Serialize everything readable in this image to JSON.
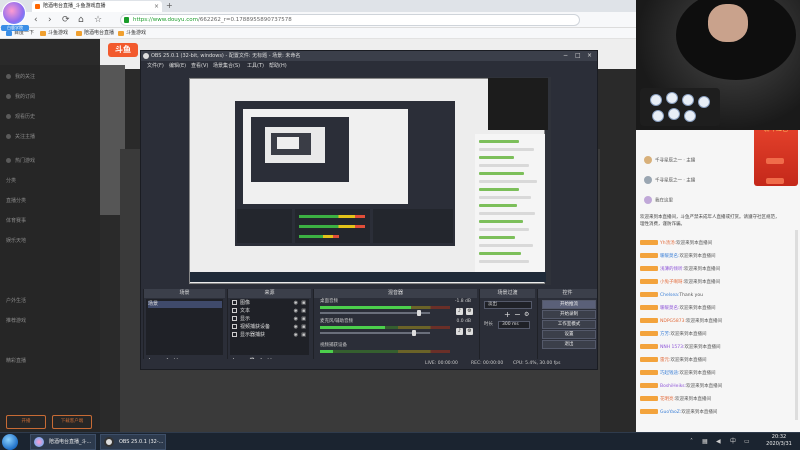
{
  "browser": {
    "logo_text": "白鹿学院",
    "tab_title": "陪酒电台直播_斗鱼游戏直播",
    "nav": {
      "back": "‹",
      "forward": "›",
      "reload": "⟳",
      "home": "⌂",
      "star": "☆"
    },
    "url_host": "https://www.douyu.com",
    "url_rest": "/662262_r=0.1788955890737578",
    "bookmarks": [
      "百度一下",
      "斗鱼游戏",
      "陪酒电台直播",
      "斗鱼游戏"
    ]
  },
  "obs": {
    "title": "OBS 25.0.1 (32-bit, windows) - 配置文件: 无标题 - 场景: 未命名",
    "menu": [
      "文件(F)",
      "编辑(E)",
      "查看(V)",
      "场景集合(S)",
      "工具(T)",
      "帮助(H)"
    ],
    "docks": {
      "scenes": {
        "header": "场景",
        "items": [
          "场景"
        ]
      },
      "sources": {
        "header": "来源",
        "items": [
          "图像",
          "文本",
          "显示",
          "视频捕获设备",
          "显示器捕获"
        ]
      },
      "mixer": {
        "header": "混音器",
        "channels": [
          {
            "name": "桌面音频",
            "db": "-1.8 dB",
            "level": 0.7,
            "volume": 0.9
          },
          {
            "name": "麦克风/辅助音频",
            "db": "0.0 dB",
            "level": 0.5,
            "volume": 0.85
          },
          {
            "name": "视频捕获设备",
            "db": "",
            "level": 0.1,
            "volume": 0.0
          }
        ]
      },
      "transitions": {
        "header": "场景过渡",
        "mode": "淡出",
        "duration_label": "时长",
        "duration": "300 ms"
      },
      "controls": {
        "header": "控件",
        "buttons": [
          "开始推流",
          "开始录制",
          "工作室模式",
          "设置",
          "退出"
        ]
      },
      "foot_add": "+",
      "foot_remove": "−",
      "foot_up": "∧",
      "foot_down": "∨",
      "foot_gear": "⚙"
    },
    "status": {
      "live": "LIVE: 00:00:00",
      "rec": "REC: 00:00:00",
      "cpu": "CPU: 5.4%, 30.00 fps"
    }
  },
  "chat": {
    "gift_text": "新年红包",
    "ranks": [
      "千寻星辰之一 · 主播",
      "千寻星辰之一 · 主播",
      "我在这里"
    ],
    "notice": "欢迎来到本直播间，斗鱼严禁未成年人直播或打赏。请遵守社区规范，理性消费，谨防诈骗。",
    "messages": [
      {
        "name": "Yh汤汤:",
        "text": "欢迎来到本直播间"
      },
      {
        "name": "暖暖莫名:",
        "text": "欢迎来到本直播间"
      },
      {
        "name": "浅薄的倾听:",
        "text": "欢迎来到本直播间"
      },
      {
        "name": "小兔子啊呀:",
        "text": "欢迎来到本直播间"
      },
      {
        "name": "Chelsea:",
        "text": "Thank you"
      },
      {
        "name": "暖暖莫名:",
        "text": "欢迎来到本直播间"
      },
      {
        "name": "NDPG5873:",
        "text": "欢迎来到本直播间"
      },
      {
        "name": "方芳:",
        "text": "欢迎来到本直播间"
      },
      {
        "name": "NNH 1573:",
        "text": "欢迎来到本直播间"
      },
      {
        "name": "雷元:",
        "text": "欢迎来到本直播间"
      },
      {
        "name": "巧起钱途:",
        "text": "欢迎来到本直播间"
      },
      {
        "name": "BoshiHeiks:",
        "text": "欢迎来到本直播间"
      },
      {
        "name": "花明亮:",
        "text": "欢迎来到本直播间"
      },
      {
        "name": "GuoYaoZ:",
        "text": "欢迎来到本直播间"
      }
    ]
  },
  "douyu": {
    "logo": "斗鱼",
    "sidebar": [
      "我的关注",
      "我的订阅",
      "观看历史",
      "关注主播",
      "热门游戏",
      "分类",
      "直播分类",
      "体育赛事",
      "娱乐天地",
      "户外生活",
      "推荐游戏",
      "精彩直播"
    ],
    "btn_left": "开播",
    "btn_right": "下载客户端"
  },
  "taskbar": {
    "items": [
      "陪酒电台直播_斗...",
      "OBS 25.0.1 (32-..."
    ],
    "time": "20:32",
    "date": "2020/3/31"
  }
}
